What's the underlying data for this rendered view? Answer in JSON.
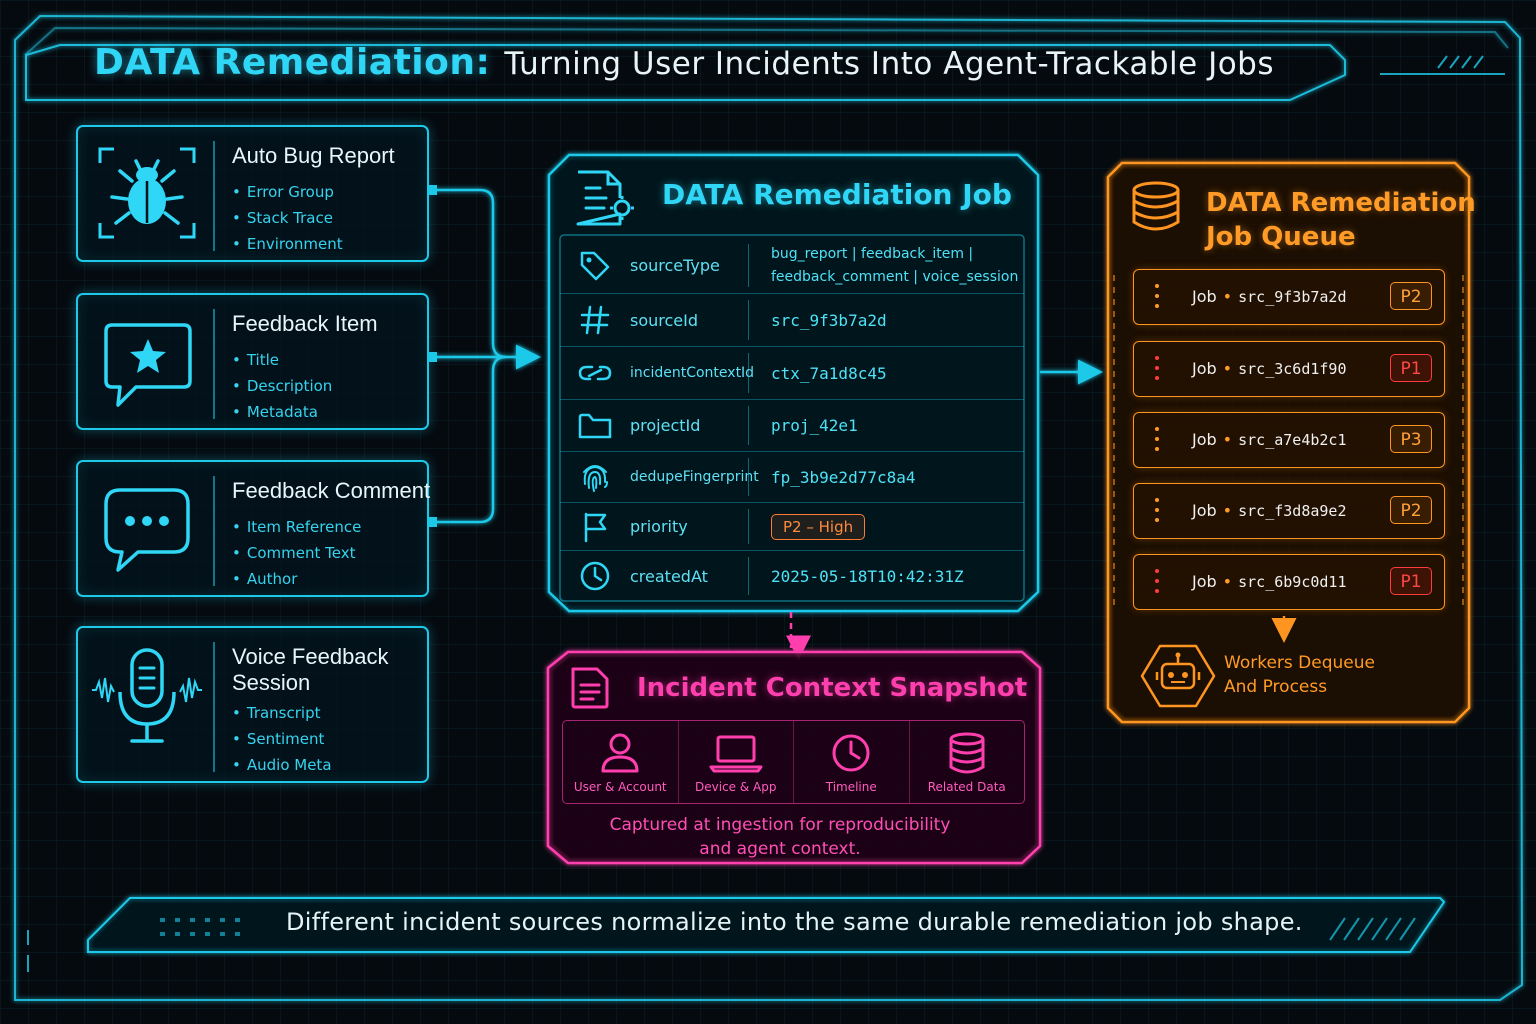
{
  "header": {
    "title_accent": "DATA Remediation:",
    "title_rest": "Turning User Incidents Into Agent-Trackable Jobs"
  },
  "sources": [
    {
      "title": "Auto Bug Report",
      "icon": "bug-icon",
      "items": [
        "Error Group",
        "Stack Trace",
        "Environment"
      ]
    },
    {
      "title": "Feedback Item",
      "icon": "star-chat-icon",
      "items": [
        "Title",
        "Description",
        "Metadata"
      ]
    },
    {
      "title": "Feedback Comment",
      "icon": "comment-icon",
      "items": [
        "Item Reference",
        "Comment Text",
        "Author"
      ]
    },
    {
      "title": [
        "Voice Feedback",
        "Session"
      ],
      "icon": "microphone-icon",
      "items": [
        "Transcript",
        "Sentiment",
        "Audio Meta"
      ]
    }
  ],
  "job": {
    "title": "DATA Remediation Job",
    "fields": [
      {
        "key": "sourceType",
        "icon": "tag-icon",
        "value_lines": [
          "bug_report | feedback_item |",
          "feedback_comment | voice_session"
        ]
      },
      {
        "key": "sourceId",
        "icon": "hash-icon",
        "value": "src_9f3b7a2d"
      },
      {
        "key": "incidentContextId",
        "icon": "link-icon",
        "value": "ctx_7a1d8c45"
      },
      {
        "key": "projectId",
        "icon": "folder-icon",
        "value": "proj_42e1"
      },
      {
        "key": "dedupeFingerprint",
        "icon": "fingerprint-icon",
        "value": "fp_3b9e2d77c8a4"
      },
      {
        "key": "priority",
        "icon": "flag-icon",
        "value": "P2 – High"
      },
      {
        "key": "createdAt",
        "icon": "clock-icon",
        "value": "2025-05-18T10:42:31Z"
      }
    ]
  },
  "snapshot": {
    "title": "Incident Context Snapshot",
    "cells": [
      {
        "label": "User & Account",
        "icon": "user-icon"
      },
      {
        "label": "Device & App",
        "icon": "laptop-icon"
      },
      {
        "label": "Timeline",
        "icon": "clock-icon"
      },
      {
        "label": "Related Data",
        "icon": "database-icon"
      }
    ],
    "note_lines": [
      "Captured at ingestion for reproducibility",
      "and agent context."
    ]
  },
  "queue": {
    "title_lines": [
      "DATA Remediation",
      "Job Queue"
    ],
    "jobs": [
      {
        "label": "Job",
        "source_id": "src_9f3b7a2d",
        "priority": "P2"
      },
      {
        "label": "Job",
        "source_id": "src_3c6d1f90",
        "priority": "P1"
      },
      {
        "label": "Job",
        "source_id": "src_a7e4b2c1",
        "priority": "P3"
      },
      {
        "label": "Job",
        "source_id": "src_f3d8a9e2",
        "priority": "P2"
      },
      {
        "label": "Job",
        "source_id": "src_6b9c0d11",
        "priority": "P1"
      }
    ],
    "workers_lines": [
      "Workers Dequeue",
      "And Process"
    ]
  },
  "footer": {
    "text": "Different incident sources normalize into the same durable remediation job shape."
  },
  "colors": {
    "cyan": "#1ec9e8",
    "magenta": "#ff3fae",
    "orange": "#ff9521",
    "red": "#ff3b3b"
  }
}
